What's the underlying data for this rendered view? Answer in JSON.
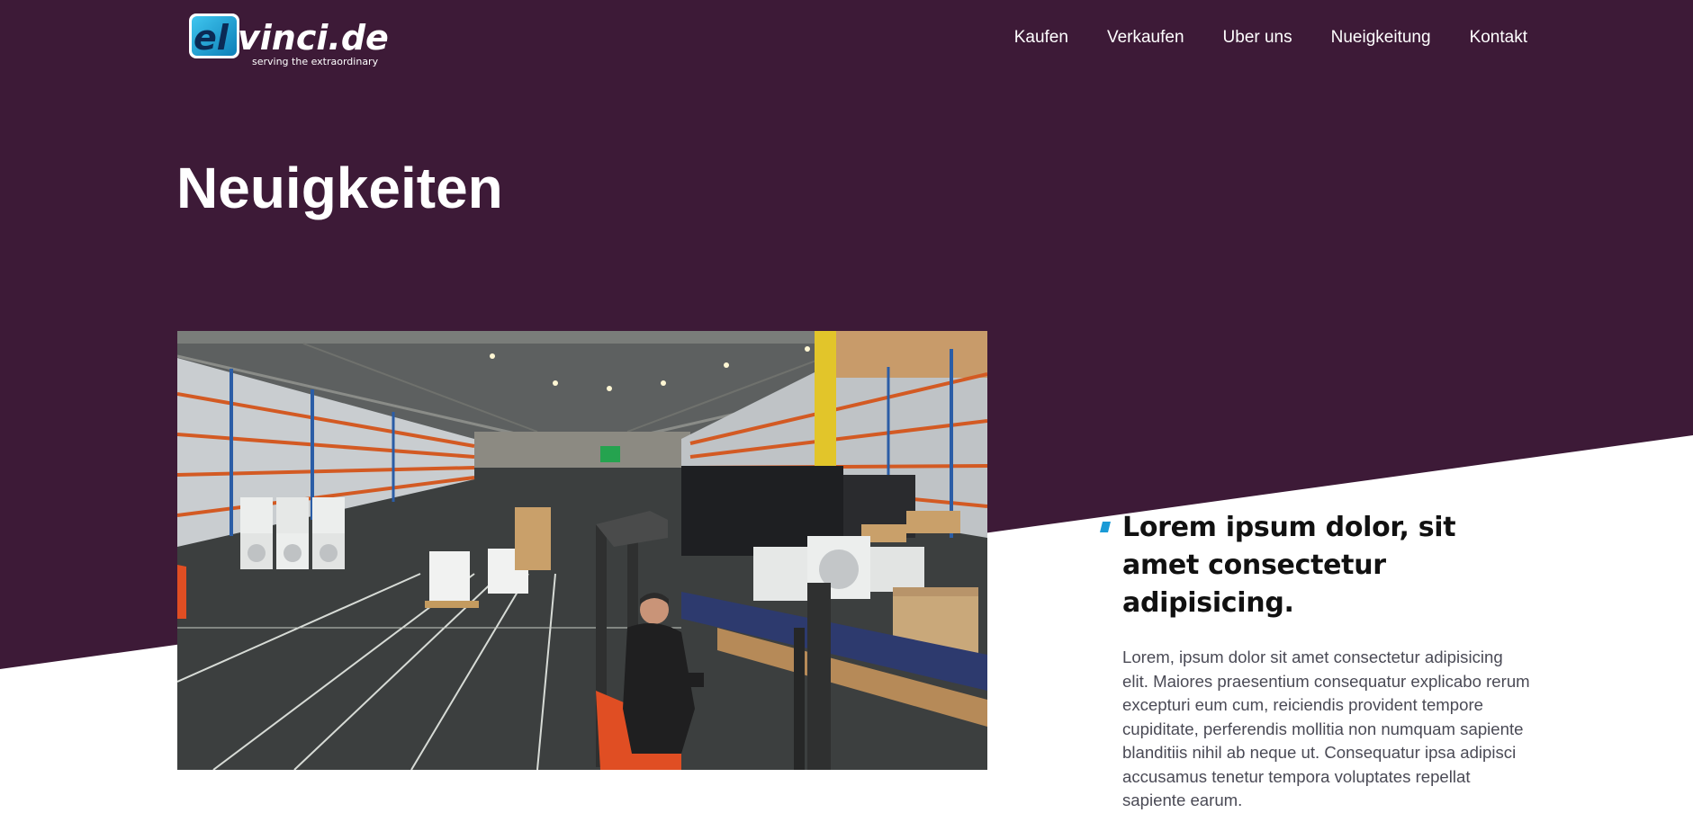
{
  "brand": {
    "logo_main_prefix": "el",
    "logo_main_suffix": "vinci.de",
    "tagline": "serving the extraordinary"
  },
  "nav": {
    "items": [
      {
        "label": "Kaufen"
      },
      {
        "label": "Verkaufen"
      },
      {
        "label": "Uber uns"
      },
      {
        "label": "Nueigkeitung"
      },
      {
        "label": "Kontakt"
      }
    ]
  },
  "page": {
    "title": "Neuigkeiten"
  },
  "article": {
    "title": "Lorem ipsum dolor, sit amet consectetur adipisicing.",
    "body": "Lorem, ipsum dolor sit amet consectetur adipisicing elit. Maiores praesentium consequatur explicabo rerum excepturi eum cum, reiciendis provident tempore cupiditate, perferendis mollitia non numquam sapiente blanditiis nihil ab neque ut. Consequatur ipsa adipisci accusamus tenetur tempora voluptates repellat sapiente earum."
  },
  "colors": {
    "hero_background": "#3d1a37",
    "accent": "#1a9ad6",
    "text_dark": "#111111",
    "text_body": "#4a4a55"
  }
}
